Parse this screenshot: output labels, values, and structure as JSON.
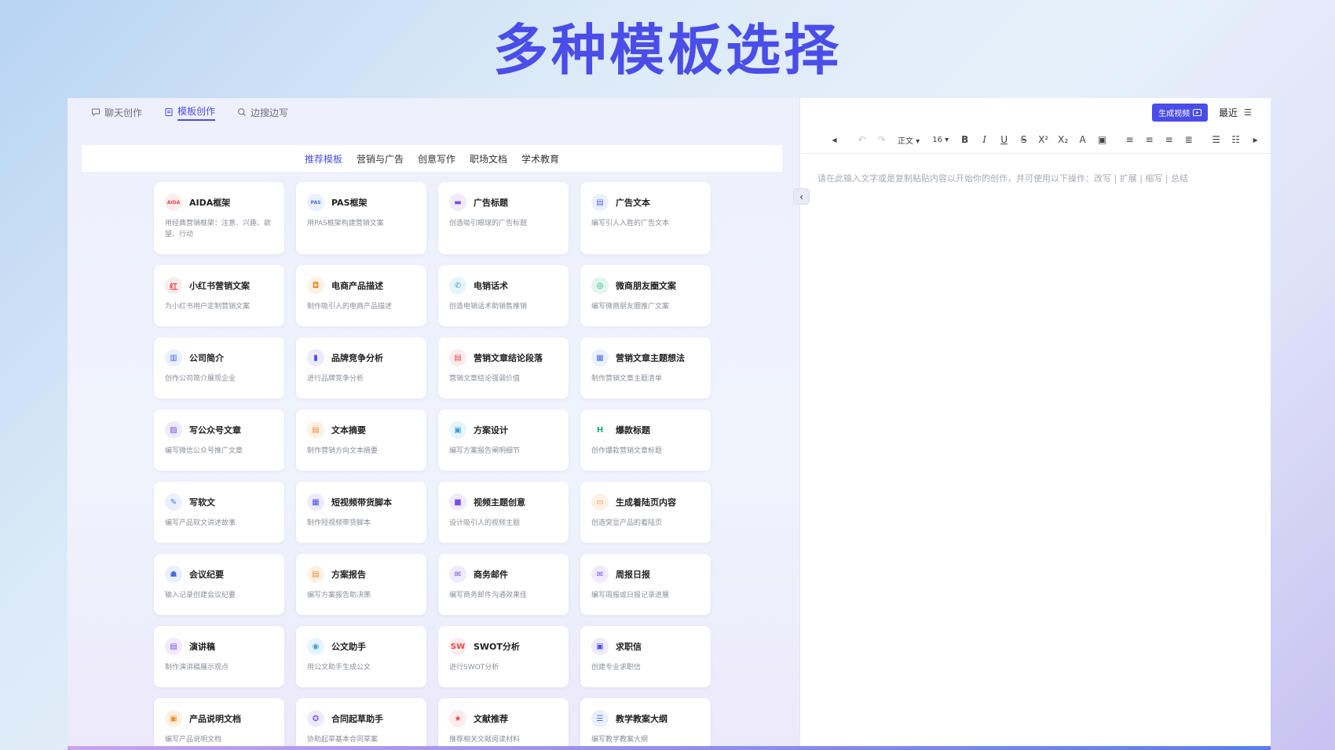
{
  "hero": {
    "title": "多种模板选择"
  },
  "top_tabs": [
    {
      "label": "聊天创作",
      "icon": "chat-icon",
      "active": false
    },
    {
      "label": "模板创作",
      "icon": "template-icon",
      "active": true
    },
    {
      "label": "边搜边写",
      "icon": "search-icon",
      "active": false
    }
  ],
  "categories": [
    {
      "label": "推荐模板",
      "active": true
    },
    {
      "label": "营销与广告",
      "active": false
    },
    {
      "label": "创意写作",
      "active": false
    },
    {
      "label": "职场文档",
      "active": false
    },
    {
      "label": "学术教育",
      "active": false
    }
  ],
  "cards": [
    {
      "title": "AIDA框架",
      "desc": "用经典营销框架：注意、兴趣、欲望、行动",
      "icon": "aida-icon",
      "glyph": "AIDA",
      "color": "#e5484d",
      "bg": "#fdecec"
    },
    {
      "title": "PAS框架",
      "desc": "用PAS框架构建营销文案",
      "icon": "pas-icon",
      "glyph": "PAS",
      "color": "#4a6ee0",
      "bg": "#eaf0fd"
    },
    {
      "title": "广告标题",
      "desc": "创造吸引眼球的广告标题",
      "icon": "billboard-icon",
      "glyph": "▬",
      "color": "#7b4fe0",
      "bg": "#f0eafd"
    },
    {
      "title": "广告文本",
      "desc": "编写引人入胜的广告文本",
      "icon": "document-icon",
      "glyph": "▤",
      "color": "#4a6ee0",
      "bg": "#eaf0fd"
    },
    {
      "title": "小红书营销文案",
      "desc": "为小红书用户定制营销文案",
      "icon": "xiaohongshu-icon",
      "glyph": "红",
      "color": "#e5484d",
      "bg": "#fdecec"
    },
    {
      "title": "电商产品描述",
      "desc": "制作吸引人的电商产品描述",
      "icon": "shopping-icon",
      "glyph": "◘",
      "color": "#f08c2a",
      "bg": "#fdf1e4"
    },
    {
      "title": "电销话术",
      "desc": "创造电销话术助销售推销",
      "icon": "phone-script-icon",
      "glyph": "✆",
      "color": "#3aa0d8",
      "bg": "#e6f4fb"
    },
    {
      "title": "微商朋友圈文案",
      "desc": "编写微商朋友圈推广文案",
      "icon": "camera-icon",
      "glyph": "◎",
      "color": "#19a97b",
      "bg": "#e2f6ef"
    },
    {
      "title": "公司简介",
      "desc": "创作公司简介展现企业",
      "icon": "building-icon",
      "glyph": "▥",
      "color": "#4a6ee0",
      "bg": "#eaf0fd"
    },
    {
      "title": "品牌竞争分析",
      "desc": "进行品牌竞争分析",
      "icon": "bar-chart-icon",
      "glyph": "▮",
      "color": "#4a4de8",
      "bg": "#ebebfd"
    },
    {
      "title": "营销文章结论段落",
      "desc": "营销文章结论强调价值",
      "icon": "article-icon",
      "glyph": "▤",
      "color": "#e5484d",
      "bg": "#fdecec"
    },
    {
      "title": "营销文章主题想法",
      "desc": "制作营销文章主题清单",
      "icon": "idea-list-icon",
      "glyph": "▦",
      "color": "#4a6ee0",
      "bg": "#eaf0fd"
    },
    {
      "title": "写公众号文章",
      "desc": "编写微信公众号推广文章",
      "icon": "edit-doc-icon",
      "glyph": "▨",
      "color": "#7b4fe0",
      "bg": "#f0eafd"
    },
    {
      "title": "文本摘要",
      "desc": "制作营销方向文本摘要",
      "icon": "summary-icon",
      "glyph": "▤",
      "color": "#f08c2a",
      "bg": "#fdf1e4"
    },
    {
      "title": "方案设计",
      "desc": "编写方案报告阐明细节",
      "icon": "clipboard-icon",
      "glyph": "▣",
      "color": "#3aa0d8",
      "bg": "#e6f4fb"
    },
    {
      "title": "爆款标题",
      "desc": "创作爆款营销文章标题",
      "icon": "heading-icon",
      "glyph": "H",
      "color": "#19a97b",
      "bg": "#ffffff"
    },
    {
      "title": "写软文",
      "desc": "编写产品软文讲述故事",
      "icon": "pen-icon",
      "glyph": "✎",
      "color": "#4a6ee0",
      "bg": "#eaf0fd"
    },
    {
      "title": "短视频带货脚本",
      "desc": "制作短视频带货脚本",
      "icon": "film-icon",
      "glyph": "▦",
      "color": "#4a4de8",
      "bg": "#ebebfd"
    },
    {
      "title": "视频主题创意",
      "desc": "设计吸引人的视频主题",
      "icon": "video-icon",
      "glyph": "■",
      "color": "#7b4fe0",
      "bg": "#f0eafd"
    },
    {
      "title": "生成着陆页内容",
      "desc": "创造突显产品的着陆页",
      "icon": "landing-page-icon",
      "glyph": "▭",
      "color": "#f08c2a",
      "bg": "#fdf1e4"
    },
    {
      "title": "会议纪要",
      "desc": "输入记录创建会议纪要",
      "icon": "meeting-icon",
      "glyph": "☗",
      "color": "#4a6ee0",
      "bg": "#eaf0fd"
    },
    {
      "title": "方案报告",
      "desc": "编写方案报告助决策",
      "icon": "report-icon",
      "glyph": "▤",
      "color": "#f08c2a",
      "bg": "#fdf1e4"
    },
    {
      "title": "商务邮件",
      "desc": "编写商务邮件沟通效果佳",
      "icon": "mail-icon",
      "glyph": "✉",
      "color": "#7b4fe0",
      "bg": "#f0eafd"
    },
    {
      "title": "周报日报",
      "desc": "编写周报或日报记录进展",
      "icon": "weekly-report-icon",
      "glyph": "✉",
      "color": "#7b4fe0",
      "bg": "#f0eafd"
    },
    {
      "title": "演讲稿",
      "desc": "制作演讲稿展示观点",
      "icon": "speech-icon",
      "glyph": "▤",
      "color": "#7b4fe0",
      "bg": "#f0eafd"
    },
    {
      "title": "公文助手",
      "desc": "用公文助手生成公文",
      "icon": "chat-bubble-icon",
      "glyph": "◉",
      "color": "#3aa0d8",
      "bg": "#e6f4fb"
    },
    {
      "title": "SWOT分析",
      "desc": "进行SWOT分析",
      "icon": "swot-icon",
      "glyph": "SW",
      "color": "#e5484d",
      "bg": "#fdecec"
    },
    {
      "title": "求职信",
      "desc": "创建专业求职信",
      "icon": "resume-icon",
      "glyph": "▣",
      "color": "#4a4de8",
      "bg": "#ebebfd"
    },
    {
      "title": "产品说明文档",
      "desc": "编写产品说明文档",
      "icon": "product-doc-icon",
      "glyph": "▣",
      "color": "#f08c2a",
      "bg": "#fdf1e4"
    },
    {
      "title": "合同起草助手",
      "desc": "协助起草基本合同草案",
      "icon": "contract-icon",
      "glyph": "✪",
      "color": "#7b4fe0",
      "bg": "#f0eafd"
    },
    {
      "title": "文献推荐",
      "desc": "推荐相关文献阅读材料",
      "icon": "star-icon",
      "glyph": "★",
      "color": "#e5484d",
      "bg": "#fdecec"
    },
    {
      "title": "教学教案大纲",
      "desc": "编写教学教案大纲",
      "icon": "list-icon",
      "glyph": "☰",
      "color": "#4a6ee0",
      "bg": "#eaf0fd"
    }
  ],
  "right": {
    "generate_video_label": "生成视频",
    "recent_label": "最近",
    "toolbar": {
      "style_select": "正文",
      "size_select": "16"
    },
    "editor_placeholder": "请在此输入文字或是复制粘贴内容以开始你的创作，并可使用以下操作：改写 | 扩展 | 缩写 | 总结"
  },
  "colors": {
    "accent": "#4a4de8"
  }
}
